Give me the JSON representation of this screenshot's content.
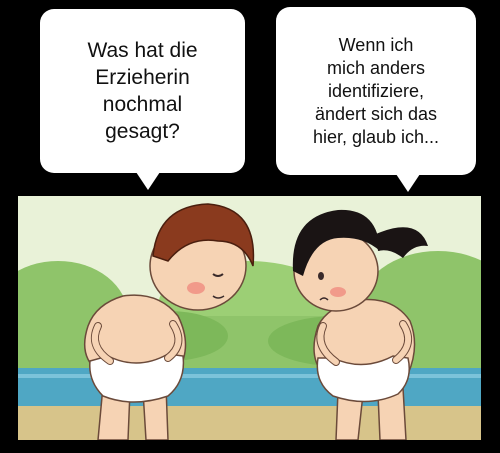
{
  "bubbles": {
    "left": {
      "text": "Was hat die\nErzieherin\nnochmal\ngesagt?"
    },
    "right": {
      "text": "Wenn ich\nmich anders\nidentifiziere,\nändert sich das\nhier, glaub ich..."
    }
  },
  "colors": {
    "background": "#000000",
    "bubble": "#ffffff",
    "sky": "#e9f2d8",
    "foliage": "#8fc46a",
    "water": "#4fa7c4",
    "ground": "#d7c48a",
    "skin": "#f6d3b4",
    "boy_hair": "#8a3a1e",
    "girl_hair": "#1a1414",
    "underwear": "#ffffff"
  },
  "scene": {
    "characters": [
      "boy",
      "girl"
    ]
  }
}
